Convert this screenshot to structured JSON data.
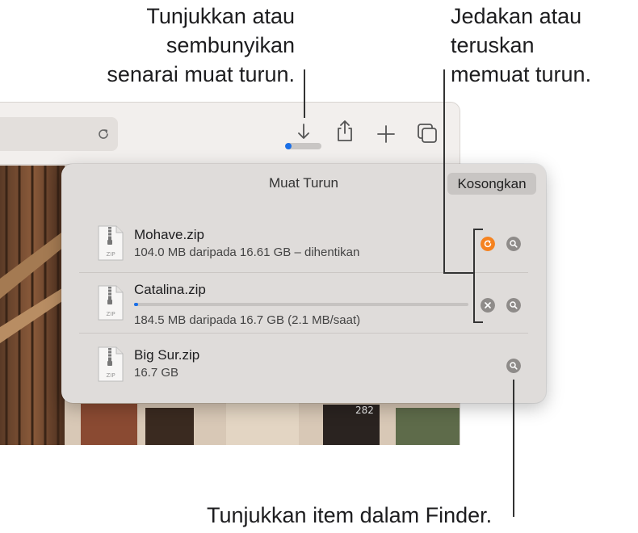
{
  "callouts": {
    "show_hide": [
      "Tunjukkan atau",
      "sembunyikan",
      "senarai muat turun."
    ],
    "pause_resume": [
      "Jedakan atau",
      "teruskan",
      "memuat turun."
    ],
    "finder": "Tunjukkan item dalam Finder."
  },
  "toolbar": {
    "reload_icon": "reload-icon",
    "download_icon": "download-arrow-icon",
    "share_icon": "share-icon",
    "new_tab_icon": "plus-icon",
    "tabs_icon": "tab-overview-icon",
    "download_progress": 0.18
  },
  "downloads": {
    "title": "Muat Turun",
    "clear_label": "Kosongkan",
    "items": [
      {
        "name": "Mohave.zip",
        "status": "104.0 MB daripada 16.61 GB – dihentikan",
        "action": "resume"
      },
      {
        "name": "Catalina.zip",
        "status": "184.5 MB daripada 16.7 GB (2.1 MB/saat)",
        "progress": 0.011,
        "action": "stop"
      },
      {
        "name": "Big Sur.zip",
        "status": "16.7 GB",
        "action": "none"
      }
    ],
    "icon_label": "ZIP"
  },
  "colors": {
    "accent_blue": "#1a6fe8",
    "resume_orange": "#f5821f",
    "control_gray": "#8e8b89"
  }
}
